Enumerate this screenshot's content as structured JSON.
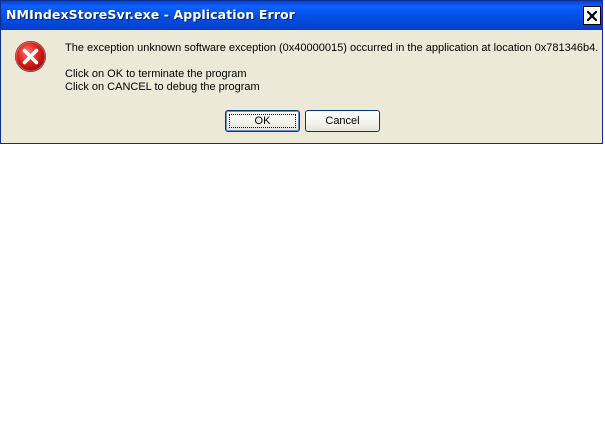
{
  "window": {
    "title": "NMIndexStoreSvr.exe - Application Error",
    "close_icon": "close-icon"
  },
  "dialog": {
    "icon": "error-icon",
    "message_line_1": "The exception unknown software exception (0x40000015) occurred in the application at location 0x781346b4.",
    "message_line_2": "Click on OK to terminate the program",
    "message_line_3": "Click on CANCEL to debug the program"
  },
  "buttons": {
    "ok_label": "OK",
    "cancel_label": "Cancel"
  },
  "colors": {
    "titlebar": "#0550e5",
    "dialog_bg": "#ece9d8",
    "error_red": "#d9141a"
  }
}
